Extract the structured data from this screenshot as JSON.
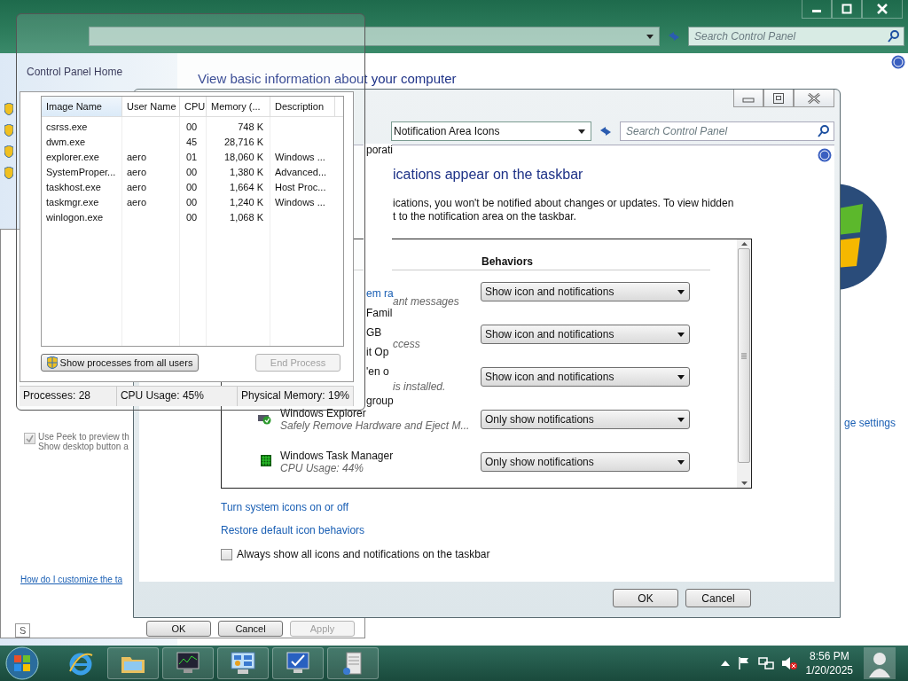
{
  "system_window": {
    "search_placeholder": "Search Control Panel",
    "sidebar_link": "Control Panel Home",
    "heading": "View basic information about your computer",
    "fragments": [
      "porati",
      "em ra",
      "Famil",
      "GB",
      "it Op",
      "'en o",
      "group"
    ],
    "side_link": "ge settings"
  },
  "taskbar_properties": {
    "peek_checkbox": {
      "lines": [
        "Use Peek to preview th",
        "Show desktop button a"
      ],
      "checked": true,
      "disabled": true
    },
    "help_link": "How do I customize the ta",
    "tab_fragment": "S",
    "buttons": [
      {
        "label": "OK",
        "disabled": false
      },
      {
        "label": "Cancel",
        "disabled": false
      },
      {
        "label": "Apply",
        "disabled": true
      }
    ]
  },
  "notification_window": {
    "address": "Notification Area Icons",
    "search_placeholder": "Search Control Panel",
    "heading": "ications appear on the taskbar",
    "description": [
      "ications, you won't be notified about changes or updates. To view hidden",
      "t to the notification area on the taskbar."
    ],
    "column_header": "Behaviors",
    "rows": [
      {
        "detail": "ant messages",
        "behavior": "Show icon and notifications"
      },
      {
        "detail": "ccess",
        "behavior": "Show icon and notifications"
      },
      {
        "detail": "is installed.",
        "behavior": "Show icon and notifications"
      },
      {
        "name": "Windows Explorer",
        "detail": "Safely Remove Hardware and Eject M...",
        "behavior": "Only show notifications"
      },
      {
        "name": "Windows Task Manager",
        "detail": "CPU Usage: 44%",
        "behavior": "Only show notifications"
      }
    ],
    "links": [
      "Turn system icons on or off",
      "Restore default icon behaviors"
    ],
    "always_show": {
      "label": "Always show all icons and notifications on the taskbar",
      "checked": false
    },
    "buttons": [
      "OK",
      "Cancel"
    ]
  },
  "task_manager": {
    "columns": [
      "Image Name",
      "User Name",
      "CPU",
      "Memory (...",
      "Description"
    ],
    "rows": [
      {
        "image": "csrss.exe",
        "cpu": "00",
        "memory": "748 K"
      },
      {
        "image": "dwm.exe",
        "cpu": "45",
        "memory": "28,716 K"
      },
      {
        "image": "explorer.exe",
        "user": "aero",
        "cpu": "01",
        "memory": "18,060 K",
        "description": "Windows ..."
      },
      {
        "image": "SystemProper...",
        "user": "aero",
        "cpu": "00",
        "memory": "1,380 K",
        "description": "Advanced..."
      },
      {
        "image": "taskhost.exe",
        "user": "aero",
        "cpu": "00",
        "memory": "1,664 K",
        "description": "Host Proc..."
      },
      {
        "image": "taskmgr.exe",
        "user": "aero",
        "cpu": "00",
        "memory": "1,240 K",
        "description": "Windows ..."
      },
      {
        "image": "winlogon.exe",
        "cpu": "00",
        "memory": "1,068 K"
      }
    ],
    "buttons": [
      {
        "label": "Show processes from all users",
        "disabled": false
      },
      {
        "label": "End Process",
        "disabled": true
      }
    ],
    "status": [
      "Processes: 28",
      "CPU Usage: 45%",
      "Physical Memory: 19%"
    ]
  },
  "taskbar": {
    "apps": [
      {
        "kind": "ie"
      },
      {
        "kind": "folder"
      },
      {
        "kind": "task-manager"
      },
      {
        "kind": "control-panel"
      },
      {
        "kind": "monitor"
      },
      {
        "kind": "server"
      }
    ],
    "clock": {
      "time": "8:56 PM",
      "date": "1/20/2025"
    }
  }
}
